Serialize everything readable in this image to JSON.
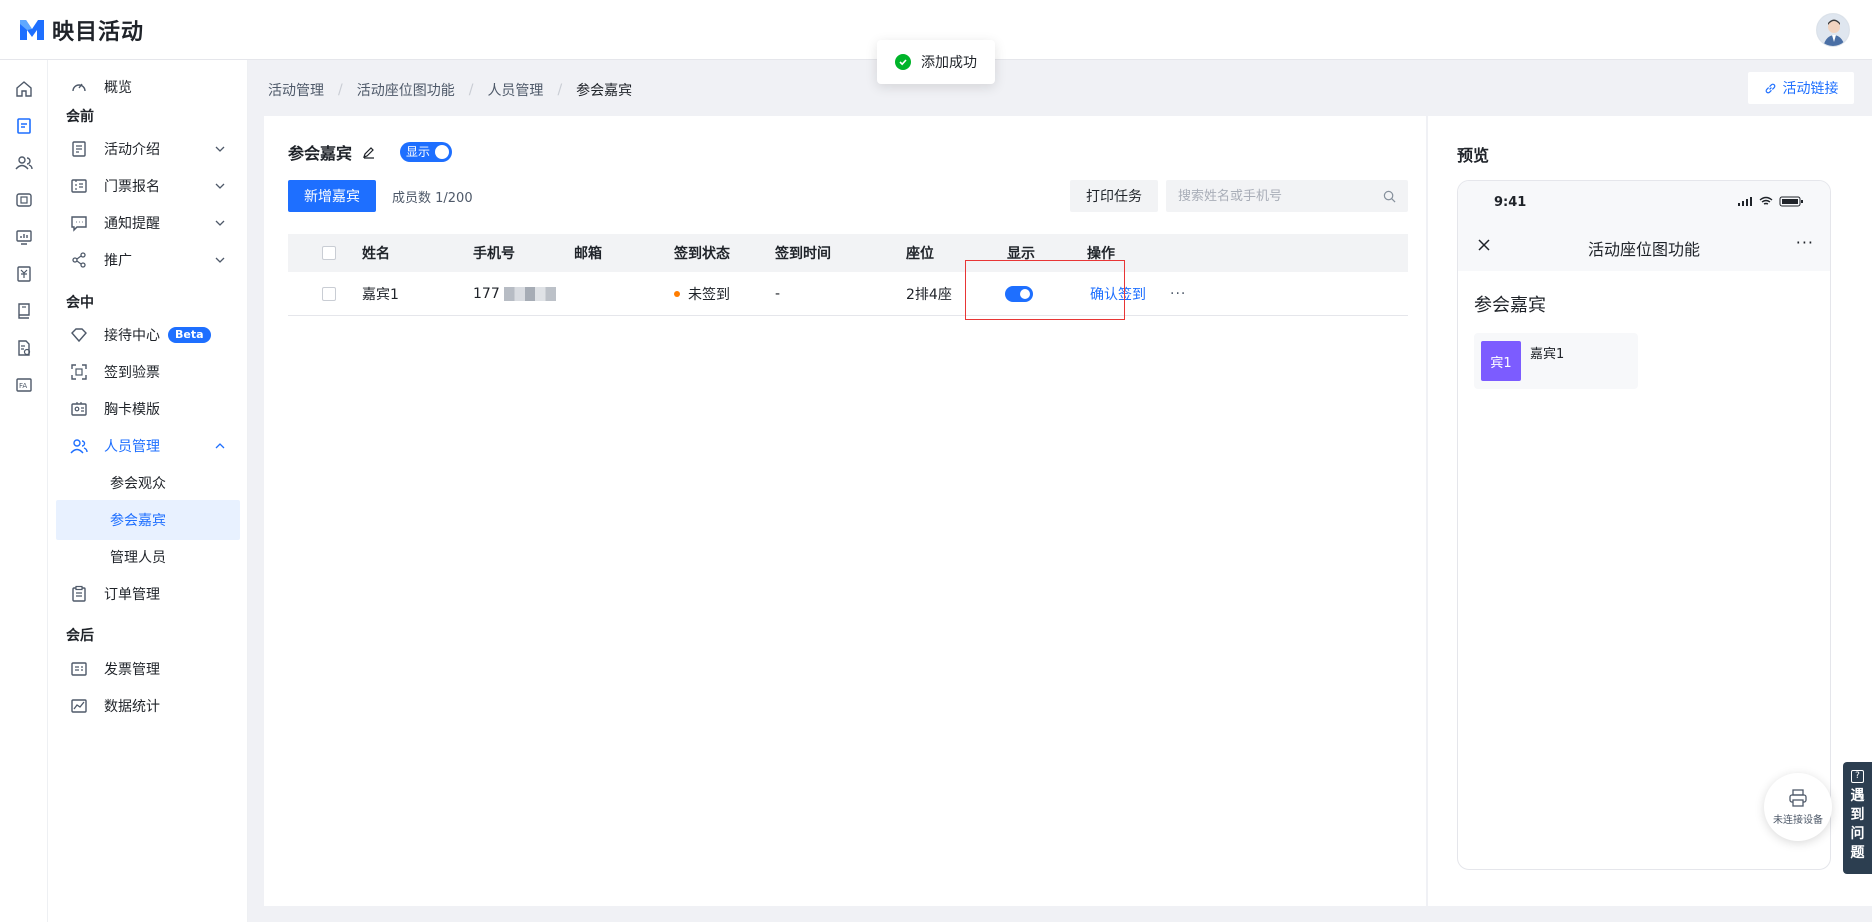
{
  "app": {
    "name": "映目活动",
    "brand_color": "#1e6fff"
  },
  "toast": {
    "text": "添加成功",
    "icon": "check-circle-icon",
    "color": "#00b42a"
  },
  "icon_rail": [
    "home-icon",
    "activity-icon",
    "people-icon",
    "media-icon",
    "screen-icon",
    "finance-icon",
    "book-icon",
    "report-icon",
    "fa-icon",
    "diamond-icon"
  ],
  "sidebar": {
    "overview": "概览",
    "groups": {
      "pre": "会前",
      "during": "会中",
      "post": "会后"
    },
    "items": {
      "intro": "活动介绍",
      "tickets": "门票报名",
      "notify": "通知提醒",
      "promote": "推广",
      "reception": "接待中心",
      "reception_badge": "Beta",
      "checkin": "签到验票",
      "badge_template": "胸卡模版",
      "people": "人员管理",
      "audience": "参会观众",
      "guests": "参会嘉宾",
      "staff": "管理人员",
      "orders": "订单管理",
      "invoice": "发票管理",
      "stats": "数据统计"
    }
  },
  "breadcrumb": [
    "活动管理",
    "活动座位图功能",
    "人员管理",
    "参会嘉宾"
  ],
  "header": {
    "link_button": "活动链接"
  },
  "main": {
    "title": "参会嘉宾",
    "show_toggle": "显示",
    "add_button": "新增嘉宾",
    "member_count": "成员数 1/200",
    "print_button": "打印任务",
    "search_placeholder": "搜索姓名或手机号"
  },
  "table": {
    "columns": [
      "姓名",
      "手机号",
      "邮箱",
      "签到状态",
      "签到时间",
      "座位",
      "显示",
      "操作"
    ],
    "rows": [
      {
        "name": "嘉宾1",
        "phone": "177",
        "email": "",
        "status": "未签到",
        "status_color": "#ff7d00",
        "checkin_time": "-",
        "seat": "2排4座",
        "visible": true,
        "action": "确认签到"
      }
    ]
  },
  "preview": {
    "title": "预览",
    "phone_time": "9:41",
    "nav_title": "活动座位图功能",
    "section": "参会嘉宾",
    "guest_avatar": "宾1",
    "guest_name": "嘉宾1",
    "avatar_color": "#7c5cff"
  },
  "device_button": "未连接设备",
  "help_tab": [
    "遇",
    "到",
    "问",
    "题"
  ]
}
